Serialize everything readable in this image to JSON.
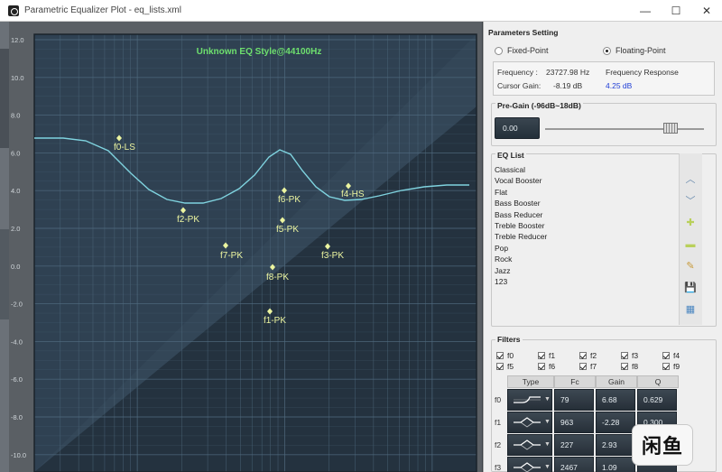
{
  "window": {
    "title": "Parametric Equalizer Plot - eq_lists.xml",
    "min_label": "—",
    "max_label": "☐",
    "close_label": "✕"
  },
  "plot": {
    "title": "Unknown EQ Style@44100Hz",
    "y_ticks": [
      "12.0",
      "10.0",
      "8.0",
      "6.0",
      "4.0",
      "2.0",
      "0.0",
      "-2.0",
      "-4.0",
      "-6.0",
      "-8.0",
      "-10.0"
    ],
    "markers": [
      {
        "label": "f0-LS",
        "freq": 79,
        "gain": 6.68
      },
      {
        "label": "f2-PK",
        "freq": 227,
        "gain": 2.93
      },
      {
        "label": "f7-PK",
        "freq": 520,
        "gain": 1.1
      },
      {
        "label": "f6-PK",
        "freq": 2150,
        "gain": 4.0
      },
      {
        "label": "f5-PK",
        "freq": 2200,
        "gain": 2.4
      },
      {
        "label": "f8-PK",
        "freq": 1750,
        "gain": 0.0
      },
      {
        "label": "f1-PK",
        "freq": 963,
        "gain": -2.28
      },
      {
        "label": "f3-PK",
        "freq": 2467,
        "gain": 1.09
      },
      {
        "label": "f4-HS",
        "freq": 5200,
        "gain": 4.3
      }
    ],
    "colors": {
      "background_light": "#2f4152",
      "background_dark": "#1b2630",
      "grid": "#4f6a7e",
      "curve": "#7fd3df",
      "marker": "#ecf5a0",
      "title": "#6ee06e"
    }
  },
  "panel": {
    "params_title": "Parameters Setting",
    "fixed_point": "Fixed-Point",
    "floating_point": "Floating-Point",
    "frequency_label": "Frequency :",
    "frequency_value": "23727.98 Hz",
    "freq_response_label": "Frequency Response",
    "cursor_gain_label": "Cursor Gain:",
    "cursor_gain_value": "-8.19 dB",
    "response_value": "4.25 dB",
    "pregain_title": "Pre-Gain (-96dB~18dB)",
    "pregain_value": "0.00",
    "pregain_level_fraction": 0.84,
    "eq_list_title": "EQ List",
    "eq_items": [
      "Classical",
      "Vocal Booster",
      "Flat",
      "Bass Booster",
      "Bass Reducer",
      "Treble Booster",
      "Treble Reducer",
      "Pop",
      "Rock",
      "Jazz",
      "123"
    ],
    "tools": [
      {
        "name": "up-icon",
        "glyph": "︿",
        "color": "#6f8fb0"
      },
      {
        "name": "down-icon",
        "glyph": "﹀",
        "color": "#6f8fb0"
      },
      {
        "name": "add-icon",
        "glyph": "✚",
        "color": "#b9d05b"
      },
      {
        "name": "remove-icon",
        "glyph": "▬",
        "color": "#b9d05b"
      },
      {
        "name": "edit-icon",
        "glyph": "✎",
        "color": "#c89a3a"
      },
      {
        "name": "save-icon",
        "glyph": "💾",
        "color": "#3b5f9a"
      },
      {
        "name": "export-icon",
        "glyph": "▦",
        "color": "#4a86c0"
      }
    ],
    "filters_title": "Filters",
    "filter_checks": [
      "f0",
      "f1",
      "f2",
      "f3",
      "f4",
      "f5",
      "f6",
      "f7",
      "f8",
      "f9"
    ],
    "table_headers": [
      "Type",
      "Fc",
      "Gain",
      "Q"
    ],
    "table_rows": [
      {
        "id": "f0",
        "fc": "79",
        "gain": "6.68",
        "q": "0.629",
        "shape": "shelf"
      },
      {
        "id": "f1",
        "fc": "963",
        "gain": "-2.28",
        "q": "0.300",
        "shape": "peak"
      },
      {
        "id": "f2",
        "fc": "227",
        "gain": "2.93",
        "q": "",
        "shape": "peak"
      },
      {
        "id": "f3",
        "fc": "2467",
        "gain": "1.09",
        "q": "",
        "shape": "peak"
      }
    ]
  },
  "watermark": "闲鱼"
}
